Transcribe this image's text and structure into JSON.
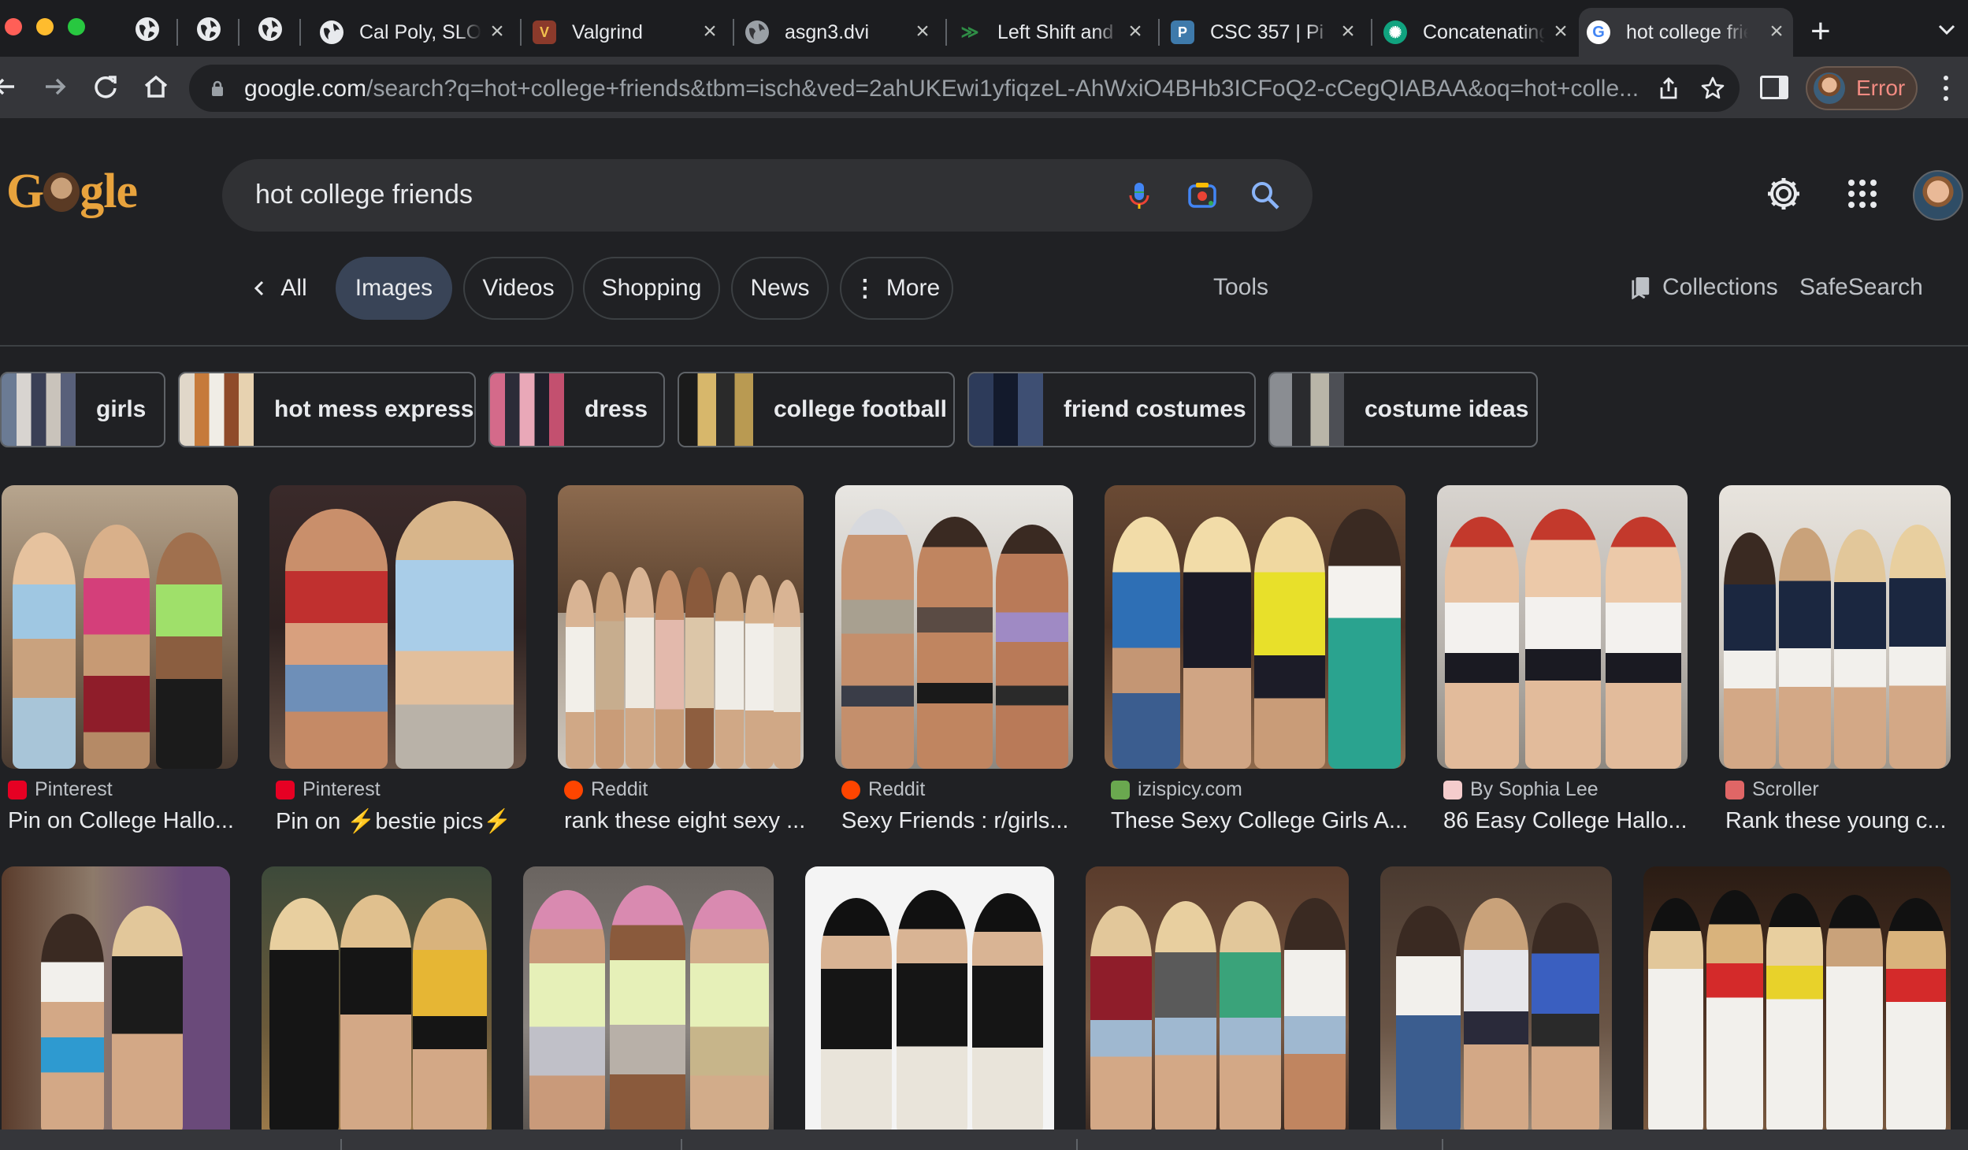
{
  "browser": {
    "tabs": [
      {
        "title": "Cal Poly, SLO",
        "favicon": "globe-icon"
      },
      {
        "title": "Valgrind",
        "favicon": "valgrind-icon"
      },
      {
        "title": "asgn3.dvi",
        "favicon": "globe-icon"
      },
      {
        "title": "Left Shift and",
        "favicon": "gfg-icon"
      },
      {
        "title": "CSC 357 | Pi",
        "favicon": "piazza-icon"
      },
      {
        "title": "Concatenating",
        "favicon": "openai-icon"
      },
      {
        "title": "hot college friends",
        "favicon": "google-icon",
        "active": true
      }
    ],
    "url_domain": "google.com",
    "url_rest": "/search?q=hot+college+friends&tbm=isch&ved=2ahUKEwi1yfiqzeL-AhWxiO4BHb3ICFoQ2-cCegQIABAA&oq=hot+colle...",
    "profile_label": "Error"
  },
  "google": {
    "logo_text": "Google",
    "query": "hot college friends",
    "nav": {
      "all": "All",
      "images": "Images",
      "videos": "Videos",
      "shopping": "Shopping",
      "news": "News",
      "more": "More",
      "tools": "Tools",
      "collections": "Collections",
      "safesearch": "SafeSearch"
    },
    "related": [
      "girls",
      "hot mess express",
      "dress",
      "college football",
      "friend costumes",
      "costume ideas"
    ],
    "results_row1": [
      {
        "source": "Pinterest",
        "caption": "Pin on College Hallo...",
        "source_icon": "pinterest-icon",
        "icon_color": "#e60023"
      },
      {
        "source": "Pinterest",
        "caption": "Pin on ⚡bestie pics⚡",
        "source_icon": "pinterest-icon",
        "icon_color": "#e60023"
      },
      {
        "source": "Reddit",
        "caption": "rank these eight sexy ...",
        "source_icon": "reddit-icon",
        "icon_color": "#ff4500"
      },
      {
        "source": "Reddit",
        "caption": "Sexy Friends : r/girls...",
        "source_icon": "reddit-icon",
        "icon_color": "#ff4500"
      },
      {
        "source": "izispicy.com",
        "caption": "These Sexy College Girls A...",
        "source_icon": "izispicy-icon",
        "icon_color": "#6aa84f"
      },
      {
        "source": "By Sophia Lee",
        "caption": "86 Easy College Hallo...",
        "source_icon": "sophia-lee-icon",
        "icon_color": "#f4cccc"
      },
      {
        "source": "Scroller",
        "caption": "Rank these young c...",
        "source_icon": "scroller-icon",
        "icon_color": "#e06666"
      }
    ],
    "results_row2_count_note": ""
  }
}
